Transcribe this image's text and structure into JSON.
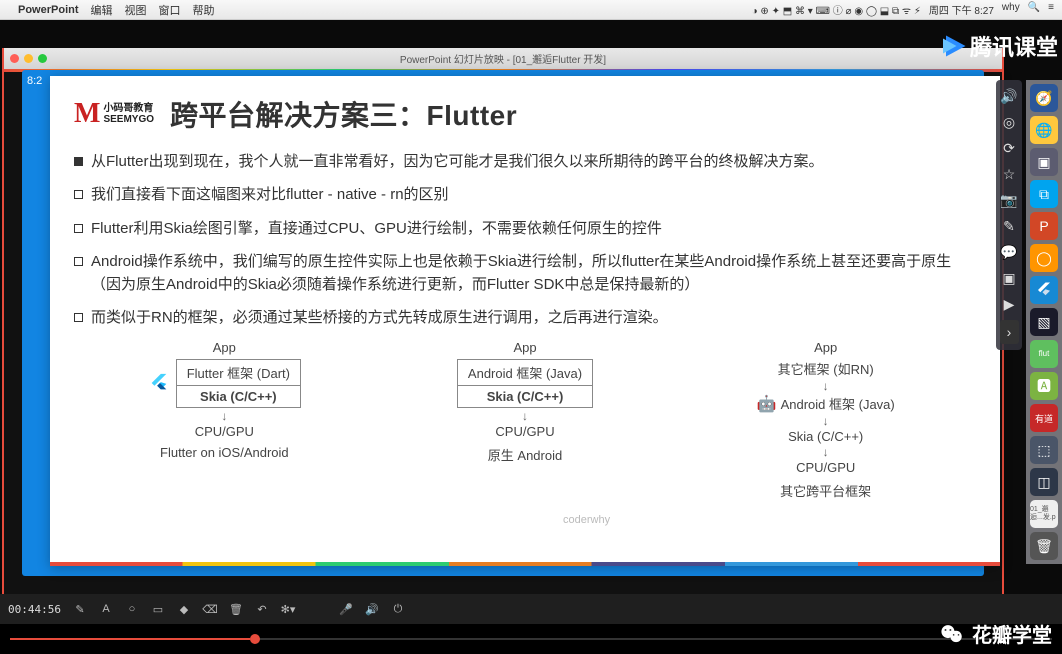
{
  "menubar": {
    "app": "PowerPoint",
    "items": [
      "编辑",
      "视图",
      "窗口",
      "帮助"
    ],
    "right_date": "周四 下午 8:27",
    "right_user": "why"
  },
  "pp_window": {
    "title": "PowerPoint 幻灯片放映 - [01_邂逅Flutter 开发]"
  },
  "slide": {
    "logo_cn": "小码哥教育",
    "logo_en": "SEEMYGO",
    "title": "跨平台解决方案三：Flutter",
    "time_badge": "8:2",
    "bullets": [
      {
        "type": "filled",
        "text": "从Flutter出现到现在，我个人就一直非常看好，因为它可能才是我们很久以来所期待的跨平台的终极解决方案。"
      },
      {
        "type": "hollow",
        "text": "我们直接看下面这幅图来对比flutter - native - rn的区别"
      },
      {
        "type": "hollow",
        "text": "Flutter利用Skia绘图引擎，直接通过CPU、GPU进行绘制，不需要依赖任何原生的控件"
      },
      {
        "type": "hollow",
        "text": "Android操作系统中，我们编写的原生控件实际上也是依赖于Skia进行绘制，所以flutter在某些Android操作系统上甚至还要高于原生（因为原生Android中的Skia必须随着操作系统进行更新，而Flutter SDK中总是保持最新的）"
      },
      {
        "type": "hollow",
        "text": "而类似于RN的框架，必须通过某些桥接的方式先转成原生进行调用，之后再进行渲染。"
      }
    ],
    "diagrams": {
      "col1": {
        "app": "App",
        "rows": [
          "Flutter 框架 (Dart)",
          "Skia (C/C++)"
        ],
        "below": "CPU/GPU",
        "caption": "Flutter on iOS/Android"
      },
      "col2": {
        "app": "App",
        "rows": [
          "Android 框架 (Java)",
          "Skia (C/C++)"
        ],
        "below": "CPU/GPU",
        "caption": "原生 Android"
      },
      "col3": {
        "app": "App",
        "lines": [
          "其它框架 (如RN)",
          "Android 框架 (Java)",
          "Skia (C/C++)",
          "CPU/GPU"
        ],
        "caption": "其它跨平台框架"
      }
    },
    "watermark": "coderwhy"
  },
  "video": {
    "timecode": "00:44:56"
  },
  "brands": {
    "tencent": "腾讯课堂",
    "huaban": "花瓣学堂"
  },
  "dock_file": {
    "name": "01_邂逅...发.p"
  }
}
